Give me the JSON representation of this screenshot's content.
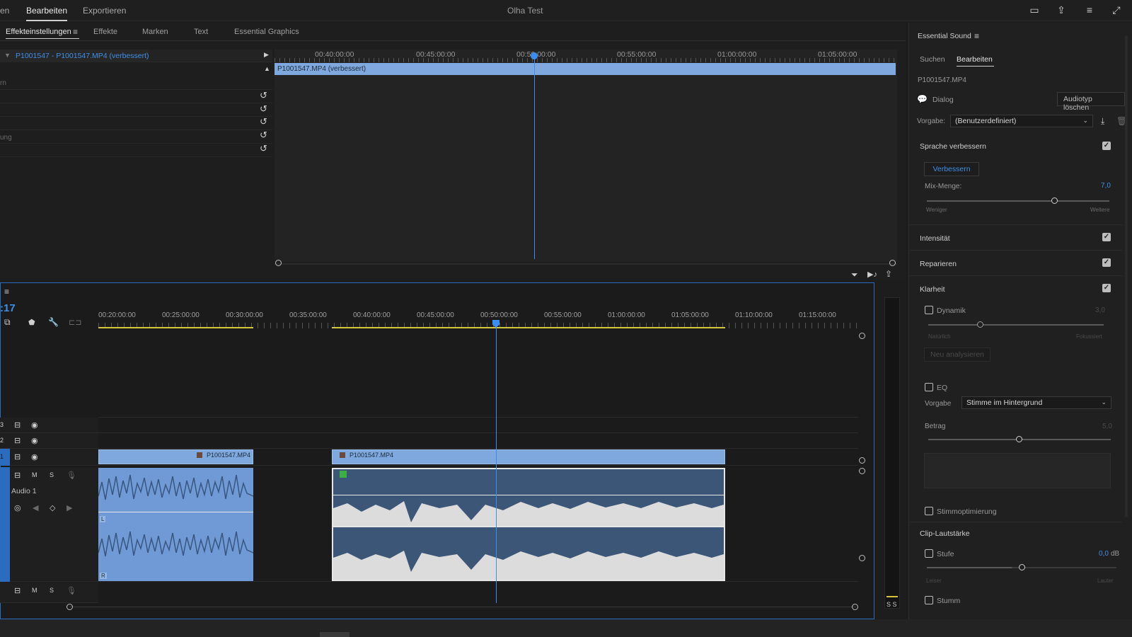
{
  "topbar": {
    "nav_partial": "en",
    "edit": "Bearbeiten",
    "export": "Exportieren",
    "title": "Olha Test"
  },
  "panel_tabs": [
    "Effekteinstellungen",
    "Effekte",
    "Marken",
    "Text",
    "Essential Graphics"
  ],
  "effects": {
    "clip_name": "P1001547 - P1001547.MP4 (verbessert)",
    "partial_labels": [
      "rn",
      "ung"
    ],
    "mini_ticks": [
      "00:40:00:00",
      "00:45:00:00",
      "00:50:00:00",
      "00:55:00:00",
      "01:00:00:00",
      "01:05:00:00"
    ],
    "mini_clip": "P1001547.MP4 (verbessert)"
  },
  "timeline": {
    "timecode": ":17",
    "ticks": [
      "00:20:00:00",
      "00:25:00:00",
      "00:30:00:00",
      "00:35:00:00",
      "00:40:00:00",
      "00:45:00:00",
      "00:50:00:00",
      "00:55:00:00",
      "01:00:00:00",
      "01:05:00:00",
      "01:10:00:00",
      "01:15:00:00"
    ],
    "track_ids": [
      "3",
      "2",
      "1"
    ],
    "clip_a": "P1001547.MP4",
    "clip_b": "P1001547.MP4",
    "audio_track": "Audio 1",
    "m": "M",
    "s": "S",
    "ch_l": "L",
    "ch_r": "R",
    "meter_s": "S S"
  },
  "essential_sound": {
    "title": "Essential Sound",
    "tabs": [
      "Suchen",
      "Bearbeiten"
    ],
    "clip": "P1001547.MP4",
    "type": "Dialog",
    "clear_type": "Audiotyp löschen",
    "preset_label": "Vorgabe:",
    "preset_value": "(Benutzerdefiniert)",
    "enhance_speech": "Sprache verbessern",
    "enhance_btn": "Verbessern",
    "mix_label": "Mix-Menge:",
    "mix_value": "7,0",
    "mix_level": 0.7,
    "mix_min": "Weniger",
    "mix_max": "Weitere",
    "loudness": "Intensität",
    "repair": "Reparieren",
    "clarity": "Klarheit",
    "dynamics": "Dynamik",
    "dynamics_value": "3,0",
    "dyn_level": 0.3,
    "dyn_min": "Natürlich",
    "dyn_max": "Fokussiert",
    "reanalyze": "Neu analysieren",
    "eq": "EQ",
    "eq_preset_label": "Vorgabe",
    "eq_preset_value": "Stimme im Hintergrund",
    "amount_label": "Betrag",
    "amount_value": "5,0",
    "amount_level": 0.5,
    "voice": "Stimmoptimierung",
    "clip_volume": "Clip-Lautstärke",
    "level_label": "Stufe",
    "level_value": "0,0",
    "level_unit": "dB",
    "level_min": "Leiser",
    "level_max": "Lauter",
    "mute": "Stumm"
  }
}
